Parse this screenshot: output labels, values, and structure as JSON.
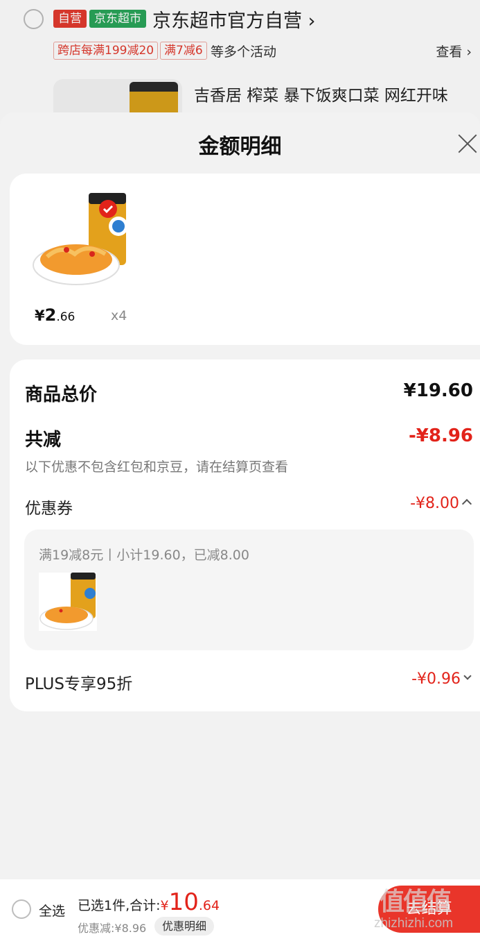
{
  "background": {
    "tags": {
      "self": "自营",
      "mart": "京东超市"
    },
    "store_name": "京东超市官方自营",
    "store_arrow": "›",
    "promos": [
      "跨店每满199减20",
      "满7减6"
    ],
    "promo_more": "等多个活动",
    "view_label": "查看 ›",
    "product_title": "吉香居 榨菜 暴下饭爽口菜 网红开味"
  },
  "sheet": {
    "title": "金额明细",
    "product": {
      "price_symbol": "¥",
      "price_int": "2",
      "price_dec": ".66",
      "quantity": "x4"
    },
    "detail": {
      "total_label": "商品总价",
      "total_value": "¥19.60",
      "reduce_label": "共减",
      "reduce_value": "-¥8.96",
      "note": "以下优惠不包含红包和京豆，请在结算页查看",
      "coupon_label": "优惠券",
      "coupon_value": "-¥8.00",
      "coupon_desc": "满19减8元丨小计19.60，已减8.00",
      "plus_label": "PLUS专享95折",
      "plus_value": "-¥0.96"
    }
  },
  "bottom_bar": {
    "select_all": "全选",
    "summary_label": "已选1件,合计:",
    "summary_symbol": "¥",
    "summary_int": "10",
    "summary_dec": ".64",
    "discount": "优惠减:¥8.96",
    "detail_button": "优惠明细",
    "checkout": "去结算"
  },
  "watermark": {
    "logo": "值值值",
    "site": "zhizhizhi.com"
  },
  "colors": {
    "accent_red": "#e2231a",
    "checkout_red": "#e9352a",
    "mart_green": "#2aa55a"
  }
}
